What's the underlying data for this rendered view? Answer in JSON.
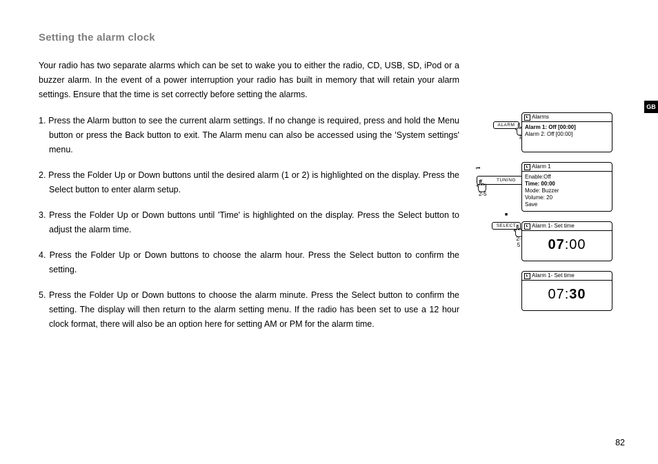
{
  "title": "Setting the alarm clock",
  "intro": "Your radio has two separate alarms which can be set to wake you to either the radio, CD, USB, SD, iPod or a buzzer alarm. In the event of a power interruption your radio has built in memory that will retain your alarm settings. Ensure that the time is set correctly before setting the alarms.",
  "steps": {
    "s1": "1. Press the Alarm button to see the current alarm settings. If no change is required, press and hold the Menu button or press the Back button to exit. The Alarm menu can also be accessed using the 'System settings' menu.",
    "s2": "2. Press the Folder Up or Down buttons until the desired alarm (1 or 2) is highlighted on the display. Press the Select button to enter alarm setup.",
    "s3": "3. Press the Folder Up or Down buttons until 'Time' is highlighted on the display. Press the Select button to adjust the alarm time.",
    "s4": "4. Press the Folder Up or Down buttons to choose the alarm hour. Press the Select button to confirm the setting.",
    "s5": "5. Press the Folder Up or Down buttons to choose the alarm minute. Press the Select button to confirm the setting. The display will then return to the alarm setting menu. If the radio has been set to use a 12 hour clock format, there will also be an option here for setting AM or PM for the alarm time."
  },
  "pagenum": "82",
  "sidetab": "GB",
  "buttons": {
    "alarm": "ALARM",
    "tuning_left": "⏮",
    "tuning_right": "⏭",
    "tuning": "TUNING",
    "select_top": "■",
    "select": "SELECT",
    "callout1": "1",
    "callout25a": "2-5",
    "callout25b": "2-5",
    "callout25c": "2-5"
  },
  "screens": {
    "s1": {
      "hdr": "Alarms",
      "l1": "Alarm 1: Off [00:00]",
      "l2": "Alarm 2: Off [00:00]"
    },
    "s2": {
      "hdr": "Alarm 1",
      "l1": "Enable:Off",
      "l2": "Time: 00:00",
      "l3": "Mode: Buzzer",
      "l4": "Volume: 20",
      "l5": "Save"
    },
    "s3": {
      "hdr": "Alarm 1- Set time",
      "hh": "07",
      "mm": ":00"
    },
    "s4": {
      "hdr": "Alarm 1- Set time",
      "hh": "07:",
      "mm": "30"
    }
  }
}
